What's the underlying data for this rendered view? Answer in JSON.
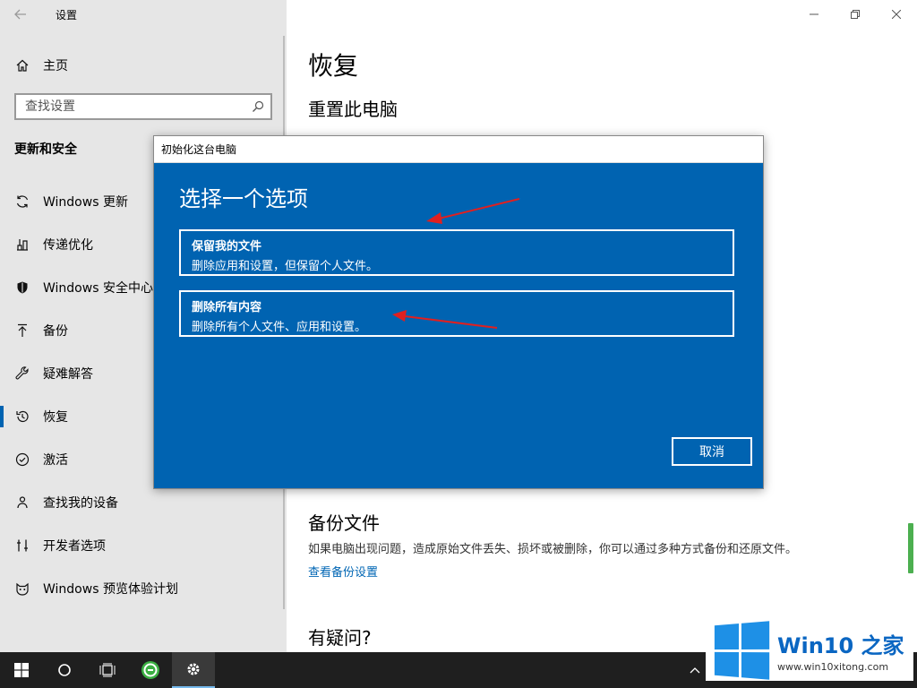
{
  "app": {
    "title": "设置",
    "back_icon": "back-arrow-icon"
  },
  "window_controls": [
    "minimize-icon",
    "restore-icon",
    "close-icon"
  ],
  "sidebar": {
    "home_label": "主页",
    "search": {
      "placeholder": "查找设置"
    },
    "section_title": "更新和安全",
    "items": [
      {
        "label": "Windows 更新",
        "icon": "sync-icon"
      },
      {
        "label": "传递优化",
        "icon": "delivery-optimization-icon"
      },
      {
        "label": "Windows 安全中心",
        "icon": "shield-icon"
      },
      {
        "label": "备份",
        "icon": "upload-arrow-icon"
      },
      {
        "label": "疑难解答",
        "icon": "wrench-icon"
      },
      {
        "label": "恢复",
        "icon": "history-icon",
        "active": true
      },
      {
        "label": "激活",
        "icon": "check-circle-icon"
      },
      {
        "label": "查找我的设备",
        "icon": "person-location-icon"
      },
      {
        "label": "开发者选项",
        "icon": "developer-tools-icon"
      },
      {
        "label": "Windows 预览体验计划",
        "icon": "insider-cat-icon"
      }
    ]
  },
  "main": {
    "title": "恢复",
    "reset_title": "重置此电脑",
    "backup": {
      "title": "备份文件",
      "description": "如果电脑出现问题，造成原始文件丢失、损坏或被删除，你可以通过多种方式备份和还原文件。",
      "link": "查看备份设置"
    },
    "question_title": "有疑问?"
  },
  "dialog": {
    "window_title": "初始化这台电脑",
    "heading": "选择一个选项",
    "options": [
      {
        "title": "保留我的文件",
        "description": "删除应用和设置，但保留个人文件。"
      },
      {
        "title": "删除所有内容",
        "description": "删除所有个人文件、应用和设置。"
      }
    ],
    "cancel_label": "取消"
  },
  "colors": {
    "accent": "#0063b1",
    "sidebar_bg": "#e6e6e6",
    "annotation_arrow": "#e02020",
    "taskbar": "#1f1f1f",
    "watermark_blue": "#0a66c2"
  },
  "taskbar": {
    "items": [
      "windows-start-icon",
      "search-circle-icon",
      "task-view-icon",
      "browser-icon",
      "settings-gear-icon"
    ],
    "tray": "chevron-up-icon"
  },
  "watermark": {
    "brand": "Win10 之家",
    "url": "www.win10xitong.com"
  }
}
